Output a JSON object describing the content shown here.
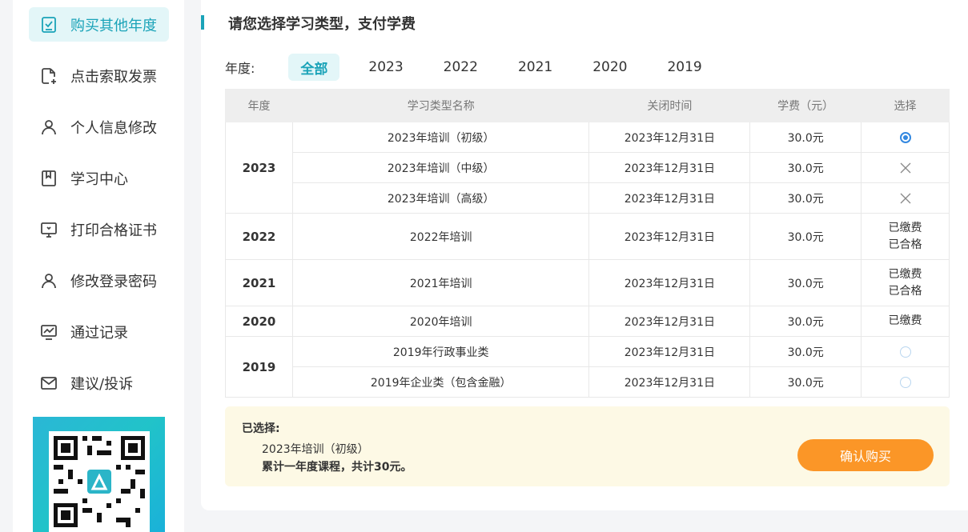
{
  "sidebar": {
    "items": [
      {
        "label": "购买其他年度",
        "icon": "checkbox-icon",
        "active": true
      },
      {
        "label": "点击索取发票",
        "icon": "document-add-icon",
        "active": false
      },
      {
        "label": "个人信息修改",
        "icon": "user-icon",
        "active": false
      },
      {
        "label": "学习中心",
        "icon": "book-icon",
        "active": false
      },
      {
        "label": "打印合格证书",
        "icon": "monitor-certificate-icon",
        "active": false
      },
      {
        "label": "修改登录密码",
        "icon": "user-lock-icon",
        "active": false
      },
      {
        "label": "通过记录",
        "icon": "chart-record-icon",
        "active": false
      },
      {
        "label": "建议/投诉",
        "icon": "mail-icon",
        "active": false
      }
    ],
    "qr": {
      "icon": "qr-code-icon"
    }
  },
  "main": {
    "title": "请您选择学习类型，支付学费",
    "year_label": "年度:",
    "year_tabs": [
      "全部",
      "2023",
      "2022",
      "2021",
      "2020",
      "2019"
    ],
    "active_year_tab": "全部",
    "table": {
      "headers": [
        "年度",
        "学习类型名称",
        "关闭时间",
        "学费（元）",
        "选择"
      ],
      "groups": [
        {
          "year": "2023",
          "rows": [
            {
              "name": "2023年培训（初级）",
              "close": "2023年12月31日",
              "fee": "30.0元",
              "select": "radio-checked"
            },
            {
              "name": "2023年培训（中级）",
              "close": "2023年12月31日",
              "fee": "30.0元",
              "select": "x"
            },
            {
              "name": "2023年培训（高级）",
              "close": "2023年12月31日",
              "fee": "30.0元",
              "select": "x"
            }
          ]
        },
        {
          "year": "2022",
          "rows": [
            {
              "name": "2022年培训",
              "close": "2023年12月31日",
              "fee": "30.0元",
              "select": "status",
              "status1": "已缴费",
              "status2": "已合格"
            }
          ]
        },
        {
          "year": "2021",
          "rows": [
            {
              "name": "2021年培训",
              "close": "2023年12月31日",
              "fee": "30.0元",
              "select": "status",
              "status1": "已缴费",
              "status2": "已合格"
            }
          ]
        },
        {
          "year": "2020",
          "rows": [
            {
              "name": "2020年培训",
              "close": "2023年12月31日",
              "fee": "30.0元",
              "select": "status",
              "status1": "已缴费"
            }
          ]
        },
        {
          "year": "2019",
          "rows": [
            {
              "name": "2019年行政事业类",
              "close": "2023年12月31日",
              "fee": "30.0元",
              "select": "radio"
            },
            {
              "name": "2019年企业类（包含金融）",
              "close": "2023年12月31日",
              "fee": "30.0元",
              "select": "radio"
            }
          ]
        }
      ]
    },
    "summary": {
      "label": "已选择:",
      "item": "2023年培训（初级）",
      "total": "累计一年度课程，共计30元。",
      "confirm_label": "确认购买"
    }
  },
  "colors": {
    "accent": "#1aa3b8",
    "active_bg": "#e3f6f8",
    "radio_blue": "#3388e0",
    "confirm_orange": "#fb9627",
    "summary_bg": "#fdf9e5"
  }
}
